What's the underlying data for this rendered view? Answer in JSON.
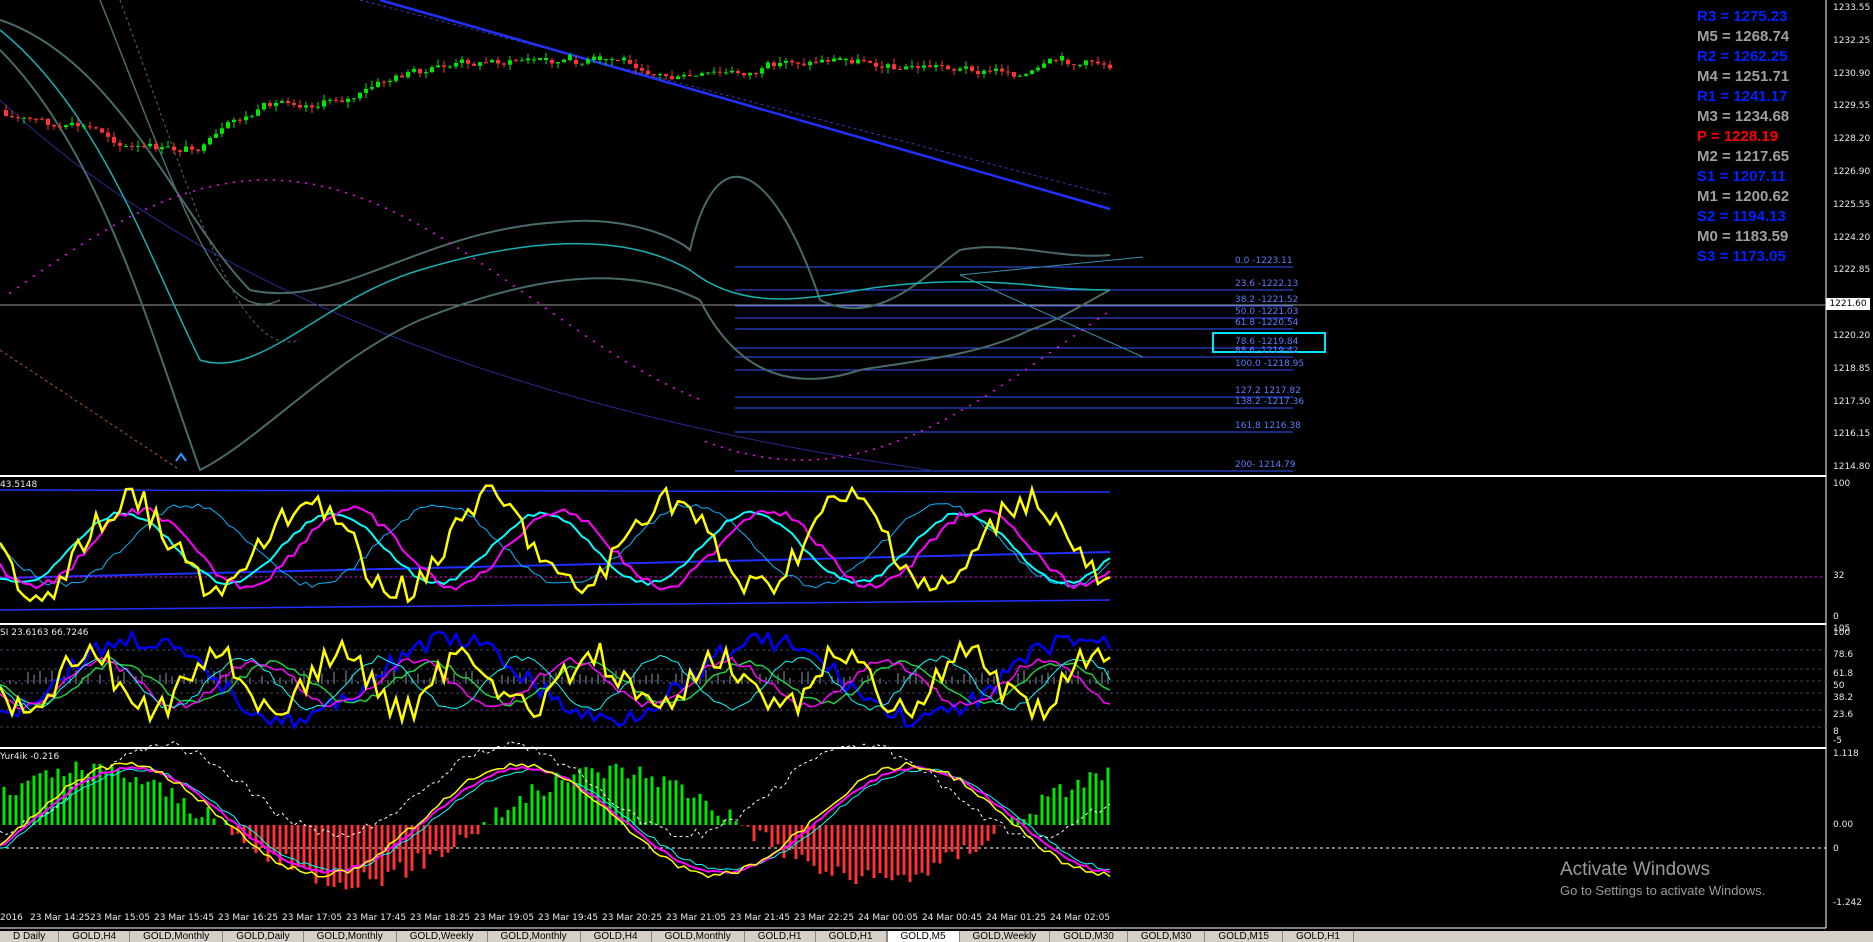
{
  "colors": {
    "bull": "#00e600",
    "bear": "#ff3333",
    "yellow": "#ffff00",
    "magenta": "#ff00ff",
    "cyan": "#00ffff",
    "blue": "#0000ff",
    "pivot_resistance": "#0022ff",
    "pivot_mid": "#a0a0a0",
    "pivot_main": "#ff0000",
    "fib_line": "#3355ff"
  },
  "pivots": [
    {
      "text": "R3 = 1275.23",
      "type": "resistance"
    },
    {
      "text": "M5 = 1268.74",
      "type": "mid"
    },
    {
      "text": "R2 = 1262.25",
      "type": "resistance"
    },
    {
      "text": "M4 = 1251.71",
      "type": "mid"
    },
    {
      "text": "R1 = 1241.17",
      "type": "resistance"
    },
    {
      "text": "M3 = 1234.68",
      "type": "mid"
    },
    {
      "text": "P   = 1228.19",
      "type": "main"
    },
    {
      "text": "M2 = 1217.65",
      "type": "mid"
    },
    {
      "text": "S1 = 1207.11",
      "type": "resistance"
    },
    {
      "text": "M1 = 1200.62",
      "type": "mid"
    },
    {
      "text": "S2 = 1194.13",
      "type": "resistance"
    },
    {
      "text": "M0 = 1183.59",
      "type": "mid"
    },
    {
      "text": "S3 = 1173.05",
      "type": "resistance"
    }
  ],
  "price_axis": [
    "1233.55",
    "1232.25",
    "1230.90",
    "1229.55",
    "1228.20",
    "1226.90",
    "1225.55",
    "1224.20",
    "1222.85",
    "1221.60",
    "1220.20",
    "1218.85",
    "1217.50",
    "1216.15",
    "1214.80"
  ],
  "current_price": "1221.60",
  "fib_levels": [
    "0.0 -1223.11",
    "23.6 -1222.13",
    "38.2 -1221.52",
    "50.0 -1221.03",
    "61.8 -1220.54",
    "78.6 -1219.84",
    "88.6 -1219.42",
    "100.0 -1218.95",
    "127.2 1217.82",
    "138.2 -1217.36",
    "161.8 1216.38",
    "200- 1214.79"
  ],
  "indicators": {
    "pane1_label": "43.5148",
    "pane1_axis": [
      "100",
      "32",
      "0"
    ],
    "pane2_label": "SI 23.6163 66.7246",
    "pane2_axis": [
      "105",
      "100",
      "78.6",
      "61.8",
      "50",
      "38.2",
      "23.6",
      "8",
      "-5",
      "0"
    ],
    "pane3_label": "Yur4ik -0.216",
    "pane3_axis": [
      "1.118",
      "0.00",
      "0",
      "-1.242"
    ]
  },
  "time_axis": [
    "2016",
    "23 Mar 14:25",
    "23 Mar 15:05",
    "23 Mar 15:45",
    "23 Mar 16:25",
    "23 Mar 17:05",
    "23 Mar 17:45",
    "23 Mar 18:25",
    "23 Mar 19:05",
    "23 Mar 19:45",
    "23 Mar 20:25",
    "23 Mar 21:05",
    "23 Mar 21:45",
    "23 Mar 22:25",
    "24 Mar 00:05",
    "24 Mar 00:45",
    "24 Mar 01:25",
    "24 Mar 02:05"
  ],
  "tabs": [
    "D Daily",
    "GOLD,H4",
    "GOLD,Monthly",
    "GOLD,Daily",
    "GOLD,Monthly",
    "GOLD,Weekly",
    "GOLD,Monthly",
    "GOLD,H4",
    "GOLD,Monthly",
    "GOLD,H1",
    "GOLD,H1",
    "GOLD,M5",
    "GOLD,Weekly",
    "GOLD,M30",
    "GOLD,M30",
    "GOLD,M15",
    "GOLD,H1"
  ],
  "active_tab_index": 11,
  "watermark": {
    "title": "Activate Windows",
    "subtitle": "Go to Settings to activate Windows."
  }
}
